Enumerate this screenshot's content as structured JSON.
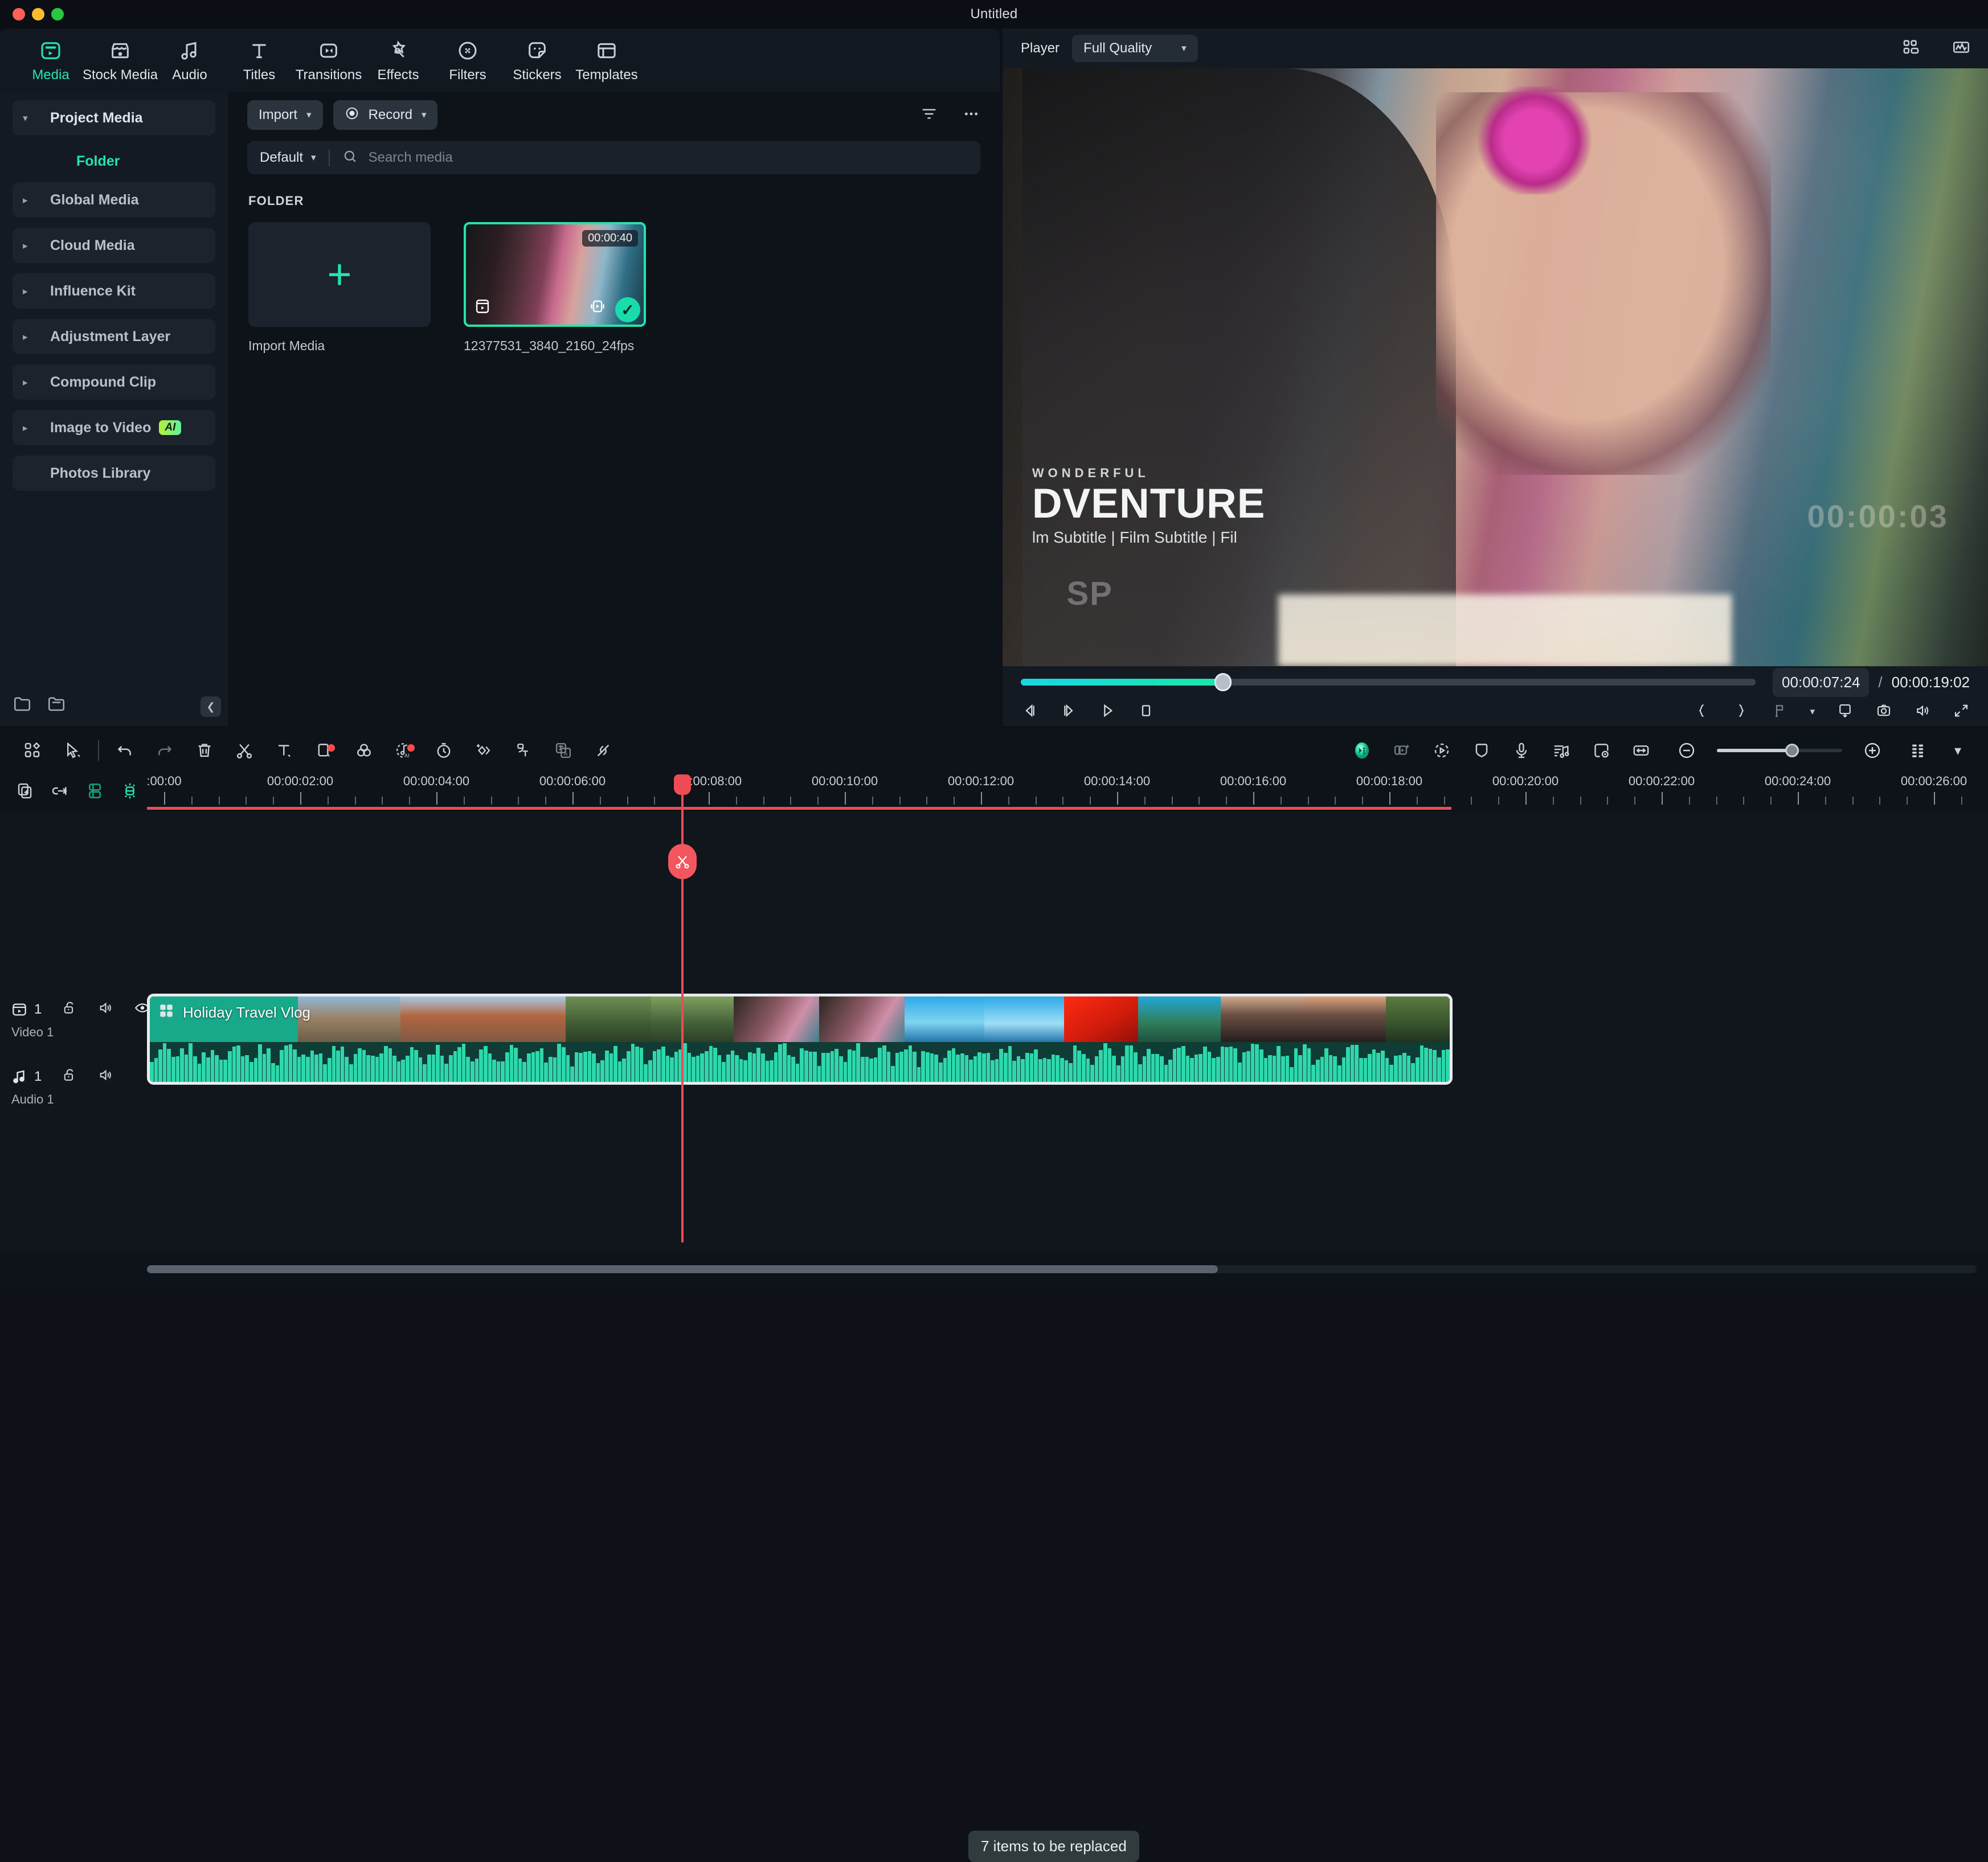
{
  "window": {
    "title": "Untitled"
  },
  "tabs": [
    {
      "label": "Media",
      "icon": "media-icon",
      "active": true
    },
    {
      "label": "Stock Media",
      "icon": "store-icon",
      "active": false
    },
    {
      "label": "Audio",
      "icon": "music-note-icon",
      "active": false
    },
    {
      "label": "Titles",
      "icon": "text-t-icon",
      "active": false
    },
    {
      "label": "Transitions",
      "icon": "transitions-icon",
      "active": false
    },
    {
      "label": "Effects",
      "icon": "magic-wand-icon",
      "active": false
    },
    {
      "label": "Filters",
      "icon": "filters-icon",
      "active": false
    },
    {
      "label": "Stickers",
      "icon": "sticker-icon",
      "active": false
    },
    {
      "label": "Templates",
      "icon": "templates-icon",
      "active": false
    }
  ],
  "sidebar": {
    "items": [
      {
        "label": "Project Media",
        "expanded": true,
        "caret": "▾"
      },
      {
        "label": "Folder",
        "selected": true
      },
      {
        "label": "Global Media",
        "caret": "▸"
      },
      {
        "label": "Cloud Media",
        "caret": "▸"
      },
      {
        "label": "Influence Kit",
        "caret": "▸"
      },
      {
        "label": "Adjustment Layer",
        "caret": "▸"
      },
      {
        "label": "Compound Clip",
        "caret": "▸"
      },
      {
        "label": "Image to Video",
        "caret": "▸",
        "badge": "AI"
      },
      {
        "label": "Photos Library"
      }
    ],
    "collapse_icon": "chevron-left-icon"
  },
  "media_panel": {
    "import_button": "Import",
    "record_button": "Record",
    "filter_icon": "filter-icon",
    "more_icon": "more-horizontal-icon",
    "sort_value": "Default",
    "search_placeholder": "Search media",
    "search_value": "",
    "search_icon": "search-icon",
    "section_title": "FOLDER",
    "import_cell_label": "Import Media",
    "items": [
      {
        "name": "12377531_3840_2160_24fps",
        "duration": "00:00:40",
        "selected": true
      }
    ]
  },
  "player": {
    "label": "Player",
    "quality": "Full Quality",
    "grid_icon": "grid-view-icon",
    "scope_icon": "waveform-scope-icon",
    "current_time": "00:00:07:24",
    "separator": "/",
    "total_time": "00:00:19:02",
    "progress_percent": 27.5,
    "controls": [
      {
        "name": "prev-frame-button",
        "icon": "prev-frame-icon"
      },
      {
        "name": "next-frame-button",
        "icon": "next-frame-icon"
      },
      {
        "name": "play-button",
        "icon": "play-icon"
      },
      {
        "name": "stop-button",
        "icon": "stop-icon"
      }
    ],
    "right_controls": [
      {
        "name": "mark-in-button",
        "icon": "brace-left-icon"
      },
      {
        "name": "mark-out-button",
        "icon": "brace-right-icon"
      },
      {
        "name": "marker-button",
        "icon": "marker-flag-icon"
      },
      {
        "name": "aspect-ratio-button",
        "icon": "aspect-ratio-icon"
      },
      {
        "name": "snapshot-button",
        "icon": "camera-icon"
      },
      {
        "name": "volume-button",
        "icon": "speaker-icon"
      },
      {
        "name": "fullscreen-button",
        "icon": "expand-icon"
      }
    ],
    "overlay": {
      "supertitle": "WONDERFUL",
      "title": "DVENTURE",
      "subtitle": "lm Subtitle | Film Subtitle | Fil",
      "watermark": "SP",
      "timecode": "00:00:03"
    }
  },
  "timeline_toolbar": {
    "left_icons": [
      {
        "name": "layout-button",
        "icon": "layout-grid-icon"
      },
      {
        "name": "select-tool-button",
        "icon": "cursor-arrow-icon"
      },
      {
        "name": "undo-button",
        "icon": "undo-arrow-icon"
      },
      {
        "name": "redo-button",
        "icon": "redo-arrow-icon"
      },
      {
        "name": "delete-button",
        "icon": "trash-icon"
      },
      {
        "name": "split-button",
        "icon": "scissors-icon"
      },
      {
        "name": "text-button",
        "icon": "text-t-icon"
      },
      {
        "name": "crop-button",
        "icon": "crop-square-icon",
        "dot": true
      },
      {
        "name": "color-button",
        "icon": "color-circles-icon"
      },
      {
        "name": "ai-audio-button",
        "icon": "ai-audio-icon",
        "dot": true
      },
      {
        "name": "speed-button",
        "icon": "stopwatch-icon"
      },
      {
        "name": "keyframe-button",
        "icon": "keyframe-diamond-icon"
      },
      {
        "name": "auto-caption-button",
        "icon": "auto-caption-icon"
      },
      {
        "name": "translate-button",
        "icon": "translate-icon"
      },
      {
        "name": "detach-audio-button",
        "icon": "unlink-icon"
      }
    ],
    "right_icons": [
      {
        "name": "ai-copilot-button",
        "icon": "ai-orb-icon",
        "active": true
      },
      {
        "name": "smart-cutout-button",
        "icon": "smart-cutout-icon"
      },
      {
        "name": "motion-tracking-button",
        "icon": "motion-track-icon"
      },
      {
        "name": "mask-button",
        "icon": "shield-mask-icon"
      },
      {
        "name": "voiceover-button",
        "icon": "microphone-icon"
      },
      {
        "name": "audio-mixer-button",
        "icon": "audio-mixer-icon"
      },
      {
        "name": "record-screen-button",
        "icon": "record-screen-icon"
      },
      {
        "name": "fit-timeline-button",
        "icon": "fit-width-icon"
      },
      {
        "name": "zoom-out-button",
        "icon": "minus-circle-icon"
      },
      {
        "name": "zoom-in-button",
        "icon": "plus-circle-icon"
      },
      {
        "name": "track-manager-button",
        "icon": "dots-grid-icon"
      },
      {
        "name": "more-menu-button",
        "icon": "caret-down-icon"
      }
    ],
    "zoom_percent": 60
  },
  "ruler": {
    "left_icons": [
      {
        "name": "add-track-button",
        "icon": "add-page-icon"
      },
      {
        "name": "link-button",
        "icon": "link-arrow-icon"
      },
      {
        "name": "group-button",
        "icon": "group-icon",
        "accent": true
      },
      {
        "name": "magnet-snap-button",
        "icon": "magnet-icon",
        "accent": true
      }
    ],
    "labels": [
      ":00:00",
      "00:00:02:00",
      "00:00:04:00",
      "00:00:06:00",
      "00:00:08:00",
      "00:00:10:00",
      "00:00:12:00",
      "00:00:14:00",
      "00:00:16:00",
      "00:00:18:00",
      "00:00:20:00",
      "00:00:22:00",
      "00:00:24:00",
      "00:00:26:00"
    ],
    "playhead_time": "00:00:08:00"
  },
  "tracks": [
    {
      "name": "Video 1",
      "count": "1",
      "icons": [
        "video-track-icon",
        "unlock-icon",
        "speaker-icon",
        "eye-icon"
      ]
    },
    {
      "name": "Audio 1",
      "count": "1",
      "icons": [
        "audio-track-icon",
        "unlock-icon",
        "speaker-icon"
      ]
    }
  ],
  "clip": {
    "label": "Holiday Travel Vlog",
    "icon": "template-grid-icon",
    "tooltip": "7 items to be replaced"
  },
  "colors": {
    "accent": "#24e3ad",
    "playhead": "#ef4b54",
    "clip_green": "#1fa98a",
    "waveform": "#2fd7ac",
    "panel_bg": "#141a22",
    "app_bg": "#0e1319"
  }
}
